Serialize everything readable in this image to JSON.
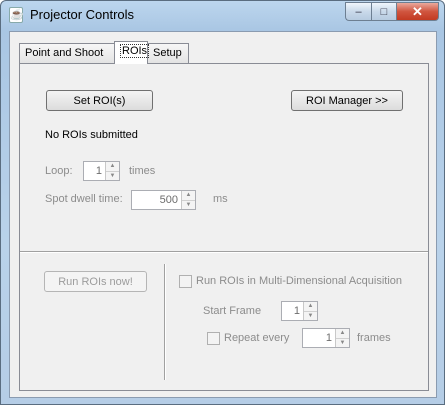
{
  "window": {
    "title": "Projector Controls",
    "icon": "java-coffee-icon",
    "controls": {
      "minimize": "–",
      "maximize": "□",
      "close": "✕"
    }
  },
  "tabs": [
    {
      "label": "Point and Shoot",
      "selected": false
    },
    {
      "label": "ROIs",
      "selected": true
    },
    {
      "label": "Setup",
      "selected": false
    }
  ],
  "rois": {
    "set_roi_label": "Set ROI(s)",
    "roi_manager_label": "ROI Manager >>",
    "status": "No ROIs submitted",
    "loop_label": "Loop:",
    "loop_value": "1",
    "loop_unit": "times",
    "dwell_label": "Spot dwell time:",
    "dwell_value": "500",
    "dwell_unit": "ms",
    "run_now_label": "Run ROIs now!",
    "mda_label": "Run ROIs in Multi-Dimensional Acquisition",
    "start_frame_label": "Start Frame",
    "start_frame_value": "1",
    "repeat_label": "Repeat every",
    "repeat_value": "1",
    "repeat_unit": "frames"
  }
}
